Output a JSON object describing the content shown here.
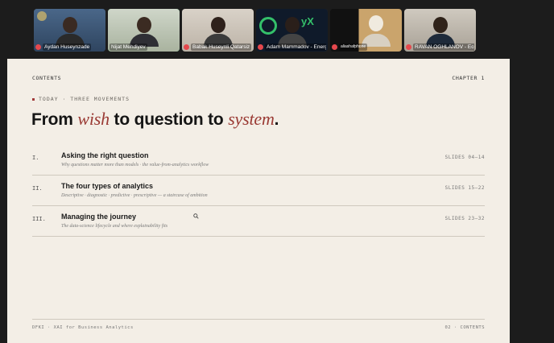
{
  "participants": [
    {
      "name": "Aydan Huseynzade",
      "muted": true,
      "active": false
    },
    {
      "name": "Nijat Mehdiyev",
      "muted": false,
      "active": true
    },
    {
      "name": "Babak Huseynli Qatarsiz",
      "muted": true,
      "active": false
    },
    {
      "name": "Adam Mammadov - EnergyX",
      "muted": true,
      "active": false
    },
    {
      "name": "aliashafphone",
      "muted": true,
      "active": false
    },
    {
      "name": "RAVAN OGHLANOV - EcoSp...",
      "muted": true,
      "active": false
    }
  ],
  "slide": {
    "section_label": "CONTENTS",
    "chapter": "CHAPTER 1",
    "eyebrow": "TODAY · THREE MOVEMENTS",
    "title": {
      "part1": "From ",
      "em1": "wish",
      "part2": " to question to ",
      "em2": "system",
      "part3": "."
    },
    "toc": [
      {
        "num": "I.",
        "title": "Asking the right question",
        "subtitle": "Why questions matter more than models · the value-from-analytics workflow",
        "slides": "SLIDES 04–14"
      },
      {
        "num": "II.",
        "title": "The four types of analytics",
        "subtitle": "Descriptive · diagnostic · predictive · prescriptive — a staircase of ambition",
        "slides": "SLIDES 15–22"
      },
      {
        "num": "III.",
        "title": "Managing the journey",
        "subtitle": "The data-science lifecycle and where explainability fits",
        "slides": "SLIDES 23–32"
      }
    ],
    "footer_left": "DFKI · XAI for Business Analytics",
    "footer_right": "02 · CONTENTS"
  },
  "colors": {
    "accent": "#9a3a34",
    "slide_bg": "#f3eee6",
    "active_speaker": "#2ecc71",
    "mic_muted": "#e5484d"
  }
}
